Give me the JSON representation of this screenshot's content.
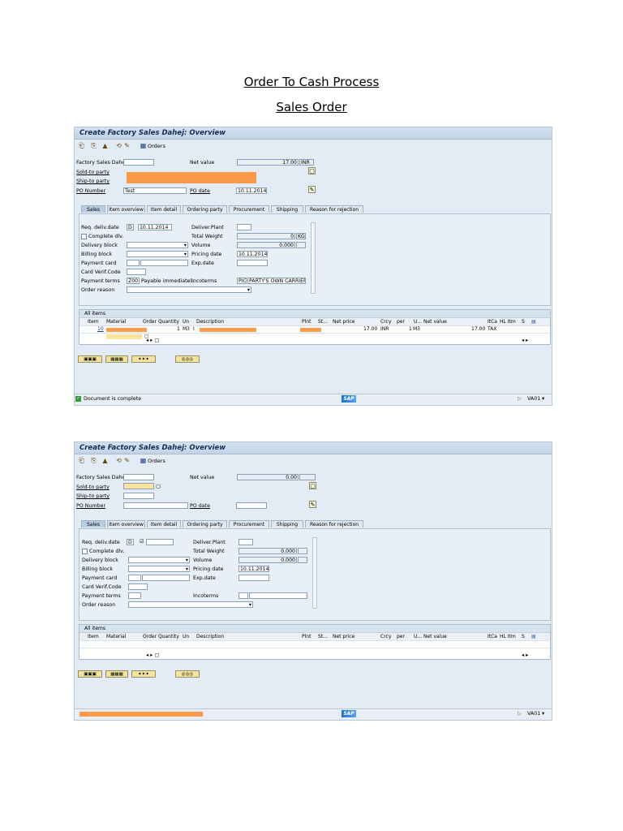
{
  "doc": {
    "title": "Order To Cash Process",
    "subtitle": "Sales Order"
  },
  "screens": [
    {
      "window_title": "Create Factory Sales Dahej: Overview",
      "toolbar": {
        "orders_label": "Orders"
      },
      "header": {
        "order_type_label": "Factory Sales Dahej",
        "order_type_value": "",
        "net_value_label": "Net value",
        "net_value": "17.00",
        "currency": "INR",
        "sold_to_label": "Sold-to party",
        "sold_to_value": "",
        "ship_to_label": "Ship-to party",
        "po_number_label": "PO Number",
        "po_number_value": "Test",
        "po_date_label": "PO date",
        "po_date_value": "10.11.2014"
      },
      "tabs": [
        "Sales",
        "Item overview",
        "Item detail",
        "Ordering party",
        "Procurement",
        "Shipping",
        "Reason for rejection"
      ],
      "sales": {
        "req_deliv_label": "Req. deliv.date",
        "req_deliv_unit": "D",
        "req_deliv_value": "10.11.2014",
        "deliver_plant_label": "Deliver.Plant",
        "deliver_plant_value": "",
        "complete_dlv_label": "Complete dlv.",
        "total_weight_label": "Total Weight",
        "total_weight_value": "0",
        "total_weight_unit": "KG",
        "delivery_block_label": "Delivery block",
        "volume_label": "Volume",
        "volume_value": "0.000",
        "volume_unit": "",
        "billing_block_label": "Billing block",
        "pricing_date_label": "Pricing date",
        "pricing_date_value": "10.11.2014",
        "payment_card_label": "Payment card",
        "exp_date_label": "Exp.date",
        "card_verif_label": "Card Verif.Code",
        "payment_terms_label": "Payment terms",
        "payment_terms_code": "Z001",
        "payment_terms_text": "Payable immediatel..",
        "incoterms_label": "Incoterms",
        "incoterms_code": "PIC",
        "incoterms_text": "PARTY'S OWN CARRIER",
        "order_reason_label": "Order reason"
      },
      "items": {
        "title": "All items",
        "columns": [
          "Item",
          "Material",
          "Order Quantity",
          "Un",
          "Description",
          "Plnt",
          "St...",
          "Net price",
          "Crcy",
          "per",
          "U...",
          "Net value",
          "ItCa",
          "HL Itm",
          "S"
        ],
        "rows": [
          {
            "item": "10",
            "qty": "1",
            "un": "M3",
            "desc_code": "I",
            "net_price": "17.00",
            "crcy": "INR",
            "per": "1",
            "u": "M3",
            "net_value": "17.00",
            "itca": "TAX"
          }
        ]
      },
      "status": {
        "message": "Document is complete",
        "transaction": "VA01"
      }
    },
    {
      "window_title": "Create Factory Sales Dahej: Overview",
      "toolbar": {
        "orders_label": "Orders"
      },
      "header": {
        "order_type_label": "Factory Sales Dahej",
        "net_value_label": "Net value",
        "net_value": "0.00",
        "currency": "",
        "sold_to_label": "Sold-to party",
        "ship_to_label": "Ship-to party",
        "po_number_label": "PO Number",
        "po_number_value": "",
        "po_date_label": "PO date",
        "po_date_value": ""
      },
      "tabs": [
        "Sales",
        "Item overview",
        "Item detail",
        "Ordering party",
        "Procurement",
        "Shipping",
        "Reason for rejection"
      ],
      "sales": {
        "req_deliv_label": "Req. deliv.date",
        "req_deliv_unit": "D",
        "req_deliv_value": "",
        "deliver_plant_label": "Deliver.Plant",
        "complete_dlv_label": "Complete dlv.",
        "total_weight_label": "Total Weight",
        "total_weight_value": "0.000",
        "delivery_block_label": "Delivery block",
        "volume_label": "Volume",
        "volume_value": "0.000",
        "billing_block_label": "Billing block",
        "pricing_date_label": "Pricing date",
        "pricing_date_value": "10.11.2014",
        "payment_card_label": "Payment card",
        "exp_date_label": "Exp.date",
        "card_verif_label": "Card Verif.Code",
        "payment_terms_label": "Payment terms",
        "incoterms_label": "Incoterms",
        "order_reason_label": "Order reason"
      },
      "items": {
        "title": "All items",
        "columns": [
          "Item",
          "Material",
          "Order Quantity",
          "Un",
          "Description",
          "Plnt",
          "St...",
          "Net price",
          "Crcy",
          "per",
          "U...",
          "Net value",
          "ItCa",
          "HL Itm",
          "S"
        ]
      },
      "status": {
        "message": "",
        "transaction": "VA01"
      }
    }
  ]
}
